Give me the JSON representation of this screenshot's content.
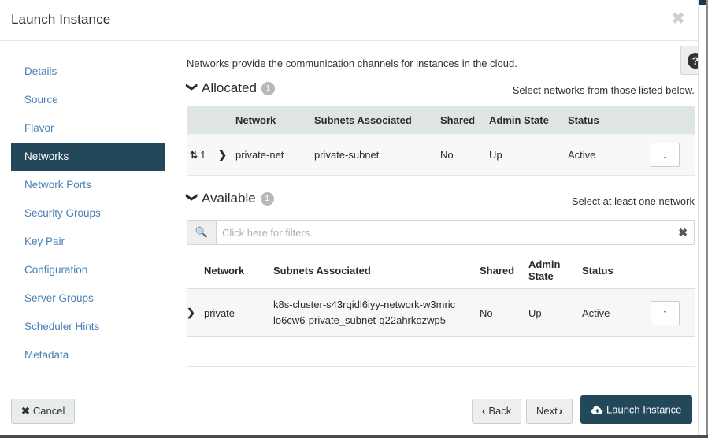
{
  "window": {
    "title": "Launch Instance",
    "close_icon": "close-icon"
  },
  "sidebar": {
    "items": [
      {
        "label": "Details",
        "active": false
      },
      {
        "label": "Source",
        "active": false
      },
      {
        "label": "Flavor",
        "active": false
      },
      {
        "label": "Networks",
        "active": true
      },
      {
        "label": "Network Ports",
        "active": false
      },
      {
        "label": "Security Groups",
        "active": false
      },
      {
        "label": "Key Pair",
        "active": false
      },
      {
        "label": "Configuration",
        "active": false
      },
      {
        "label": "Server Groups",
        "active": false
      },
      {
        "label": "Scheduler Hints",
        "active": false
      },
      {
        "label": "Metadata",
        "active": false
      }
    ]
  },
  "main": {
    "intro": "Networks provide the communication channels for instances in the cloud.",
    "help_icon": "help-icon",
    "help_glyph": "?",
    "allocated": {
      "heading": "Allocated",
      "count": "1",
      "hint": "Select networks from those listed below.",
      "columns": [
        "",
        "",
        "Network",
        "Subnets Associated",
        "Shared",
        "Admin State",
        "Status",
        ""
      ],
      "rows": [
        {
          "order": "1",
          "drag_icon": "↕",
          "expand_icon": "❯",
          "network": "private-net",
          "subnets": "private-subnet",
          "shared": "No",
          "admin_state": "Up",
          "status": "Active",
          "action_icon": "↓",
          "action_name": "demote-network-button"
        }
      ]
    },
    "available": {
      "heading": "Available",
      "count": "1",
      "hint": "Select at least one network",
      "filter": {
        "placeholder": "Click here for filters.",
        "value": "",
        "search_glyph": "⌕",
        "clear_glyph": "✖"
      },
      "columns": [
        "",
        "Network",
        "Subnets Associated",
        "Shared",
        "Admin State",
        "Status",
        ""
      ],
      "rows": [
        {
          "expand_icon": "❯",
          "network": "private",
          "subnets": "k8s-cluster-s43rqidl6iyy-network-w3mriclo6cw6-private_subnet-q22ahrkozwp5",
          "shared": "No",
          "admin_state": "Up",
          "status": "Active",
          "action_icon": "↑",
          "action_name": "promote-network-button"
        }
      ]
    }
  },
  "footer": {
    "cancel": "Cancel",
    "cancel_icon": "✖",
    "back": "Back",
    "back_icon": "‹",
    "next": "Next",
    "next_icon": "›",
    "launch": "Launch Instance",
    "launch_icon": "cloud-upload-icon"
  },
  "colors": {
    "accent_dark": "#22485a",
    "link_blue": "#4a7fb5",
    "table_header": "#dfe5e5",
    "badge_gray": "#b8b8b8"
  }
}
